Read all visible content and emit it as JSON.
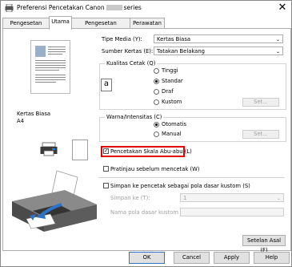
{
  "window": {
    "title_left": "Preferensi Pencetakan Canon",
    "title_right": "series",
    "close_symbol": "✕"
  },
  "tabs": [
    {
      "label": "Pengesetan Cepat"
    },
    {
      "label": "Utama"
    },
    {
      "label": "Pengesetan Halaman"
    },
    {
      "label": "Perawatan"
    }
  ],
  "preview": {
    "media_name": "Kertas Biasa",
    "paper_size": "A4"
  },
  "form": {
    "media_type_label": "Tipe Media (Y):",
    "media_type_value": "Kertas Biasa",
    "paper_source_label": "Sumber Kertas (E):",
    "paper_source_value": "Tatakan Belakang",
    "print_quality": {
      "title": "Kualitas Cetak (Q)",
      "preview_glyph": "a",
      "options": [
        "Tinggi",
        "Standar",
        "Draf",
        "Kustom"
      ],
      "selected": "Standar",
      "set_button": "Set..."
    },
    "color_intensity": {
      "title": "Warna/Intensitas (C)",
      "options": [
        "Otomatis",
        "Manual"
      ],
      "selected": "Otomatis",
      "set_button": "Set..."
    },
    "grayscale": {
      "label": "Pencetakan Skala Abu-abu (L)",
      "checked": true
    },
    "preview_before_print": {
      "label": "Pratinjau sebelum mencetak (W)",
      "checked": false
    },
    "save_custom": {
      "label": "Simpan ke pencetak sebagai pola dasar kustom (S)",
      "checked": false
    },
    "save_to_label": "Simpan ke (T):",
    "save_to_value": "1",
    "custom_name_label": "Nama pola dasar kustom"
  },
  "buttons": {
    "defaults": "Setelan Asal (F)",
    "ok": "OK",
    "cancel": "Cancel",
    "apply": "Apply",
    "help": "Help"
  },
  "checkmark": "✓",
  "dropdown_arrow": "⌄"
}
